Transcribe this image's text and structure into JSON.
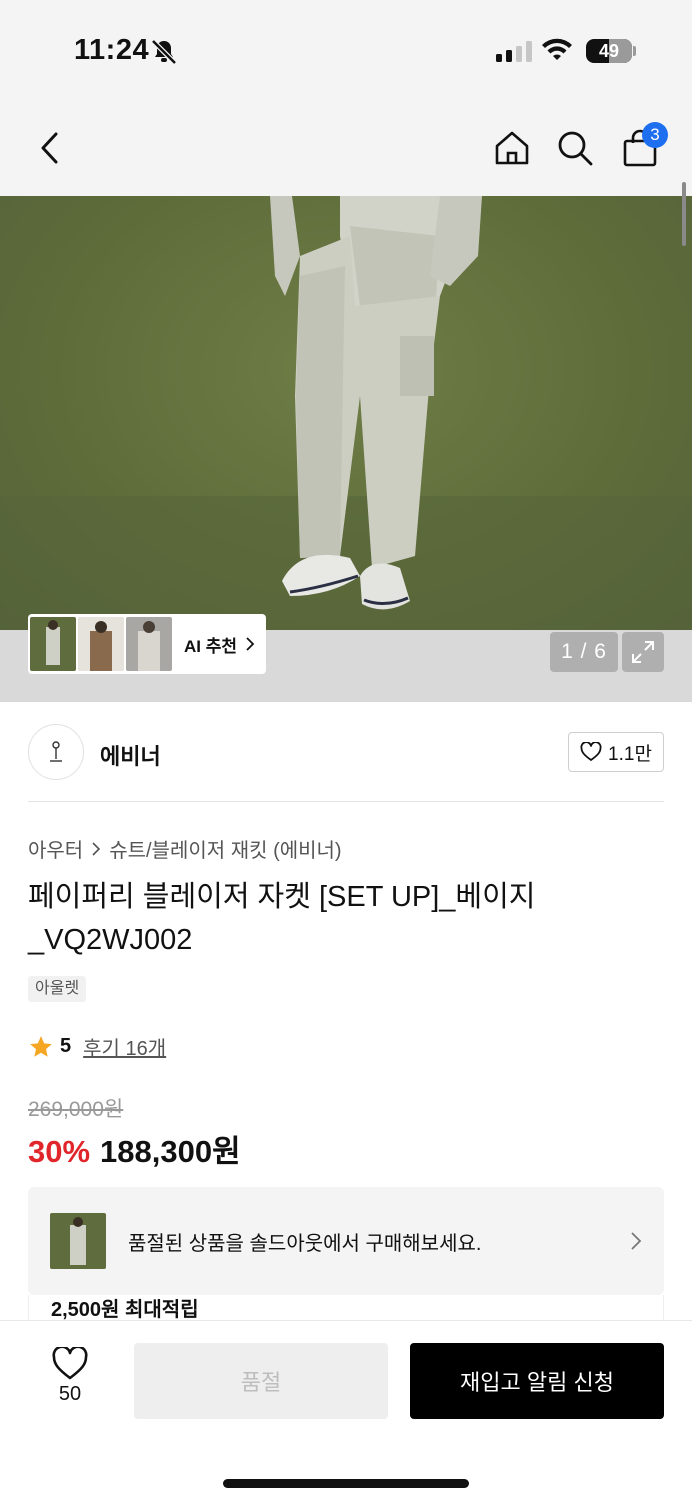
{
  "status_bar": {
    "time": "11:24",
    "battery": "49",
    "battery_level_percent": 49
  },
  "nav": {
    "cart_count": "3"
  },
  "gallery": {
    "ai_reco_label": "AI 추천",
    "counter": "1 / 6"
  },
  "brand": {
    "name": "에비너",
    "likes": "1.1만"
  },
  "product": {
    "breadcrumb": [
      "아우터",
      "슈트/블레이저 재킷 (에비너)"
    ],
    "title": "페이퍼리 블레이저 자켓 [SET UP]_베이지_VQ2WJ002",
    "tag": "아울렛",
    "rating": "5",
    "rating_max": 5,
    "review_link": "후기 16개",
    "original_price": "269,000원",
    "discount": "30%",
    "sale_price": "188,300원"
  },
  "soldout_banner": {
    "text": "품절된 상품을 솔드아웃에서 구매해보세요."
  },
  "points": {
    "text": "2,500원 최대적립"
  },
  "bottom": {
    "wish_count": "50",
    "soldout_label": "품절",
    "restock_label": "재입고 알림 신청"
  },
  "colors": {
    "accent_discount": "#e0262a",
    "badge_blue": "#1e6ef0",
    "photo_background": "#5e6c3a"
  }
}
